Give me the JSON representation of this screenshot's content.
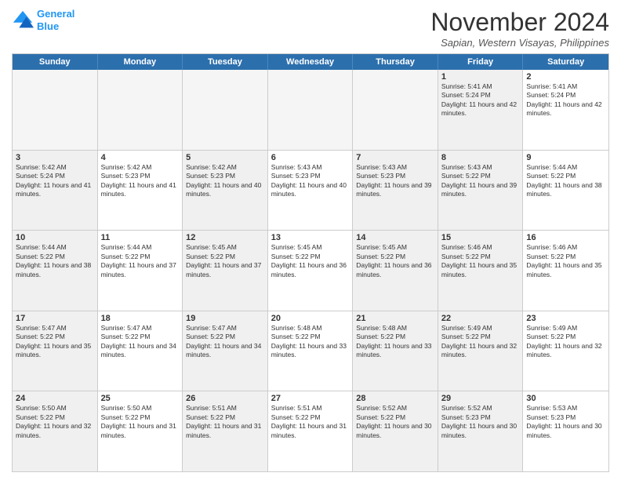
{
  "header": {
    "logo_line1": "General",
    "logo_line2": "Blue",
    "month": "November 2024",
    "location": "Sapian, Western Visayas, Philippines"
  },
  "weekdays": [
    "Sunday",
    "Monday",
    "Tuesday",
    "Wednesday",
    "Thursday",
    "Friday",
    "Saturday"
  ],
  "rows": [
    [
      {
        "day": "",
        "info": "",
        "empty": true
      },
      {
        "day": "",
        "info": "",
        "empty": true
      },
      {
        "day": "",
        "info": "",
        "empty": true
      },
      {
        "day": "",
        "info": "",
        "empty": true
      },
      {
        "day": "",
        "info": "",
        "empty": true
      },
      {
        "day": "1",
        "info": "Sunrise: 5:41 AM\nSunset: 5:24 PM\nDaylight: 11 hours and 42 minutes.",
        "shaded": true
      },
      {
        "day": "2",
        "info": "Sunrise: 5:41 AM\nSunset: 5:24 PM\nDaylight: 11 hours and 42 minutes."
      }
    ],
    [
      {
        "day": "3",
        "info": "Sunrise: 5:42 AM\nSunset: 5:24 PM\nDaylight: 11 hours and 41 minutes.",
        "shaded": true
      },
      {
        "day": "4",
        "info": "Sunrise: 5:42 AM\nSunset: 5:23 PM\nDaylight: 11 hours and 41 minutes."
      },
      {
        "day": "5",
        "info": "Sunrise: 5:42 AM\nSunset: 5:23 PM\nDaylight: 11 hours and 40 minutes.",
        "shaded": true
      },
      {
        "day": "6",
        "info": "Sunrise: 5:43 AM\nSunset: 5:23 PM\nDaylight: 11 hours and 40 minutes."
      },
      {
        "day": "7",
        "info": "Sunrise: 5:43 AM\nSunset: 5:23 PM\nDaylight: 11 hours and 39 minutes.",
        "shaded": true
      },
      {
        "day": "8",
        "info": "Sunrise: 5:43 AM\nSunset: 5:22 PM\nDaylight: 11 hours and 39 minutes.",
        "shaded": true
      },
      {
        "day": "9",
        "info": "Sunrise: 5:44 AM\nSunset: 5:22 PM\nDaylight: 11 hours and 38 minutes."
      }
    ],
    [
      {
        "day": "10",
        "info": "Sunrise: 5:44 AM\nSunset: 5:22 PM\nDaylight: 11 hours and 38 minutes.",
        "shaded": true
      },
      {
        "day": "11",
        "info": "Sunrise: 5:44 AM\nSunset: 5:22 PM\nDaylight: 11 hours and 37 minutes."
      },
      {
        "day": "12",
        "info": "Sunrise: 5:45 AM\nSunset: 5:22 PM\nDaylight: 11 hours and 37 minutes.",
        "shaded": true
      },
      {
        "day": "13",
        "info": "Sunrise: 5:45 AM\nSunset: 5:22 PM\nDaylight: 11 hours and 36 minutes."
      },
      {
        "day": "14",
        "info": "Sunrise: 5:45 AM\nSunset: 5:22 PM\nDaylight: 11 hours and 36 minutes.",
        "shaded": true
      },
      {
        "day": "15",
        "info": "Sunrise: 5:46 AM\nSunset: 5:22 PM\nDaylight: 11 hours and 35 minutes.",
        "shaded": true
      },
      {
        "day": "16",
        "info": "Sunrise: 5:46 AM\nSunset: 5:22 PM\nDaylight: 11 hours and 35 minutes."
      }
    ],
    [
      {
        "day": "17",
        "info": "Sunrise: 5:47 AM\nSunset: 5:22 PM\nDaylight: 11 hours and 35 minutes.",
        "shaded": true
      },
      {
        "day": "18",
        "info": "Sunrise: 5:47 AM\nSunset: 5:22 PM\nDaylight: 11 hours and 34 minutes."
      },
      {
        "day": "19",
        "info": "Sunrise: 5:47 AM\nSunset: 5:22 PM\nDaylight: 11 hours and 34 minutes.",
        "shaded": true
      },
      {
        "day": "20",
        "info": "Sunrise: 5:48 AM\nSunset: 5:22 PM\nDaylight: 11 hours and 33 minutes."
      },
      {
        "day": "21",
        "info": "Sunrise: 5:48 AM\nSunset: 5:22 PM\nDaylight: 11 hours and 33 minutes.",
        "shaded": true
      },
      {
        "day": "22",
        "info": "Sunrise: 5:49 AM\nSunset: 5:22 PM\nDaylight: 11 hours and 32 minutes.",
        "shaded": true
      },
      {
        "day": "23",
        "info": "Sunrise: 5:49 AM\nSunset: 5:22 PM\nDaylight: 11 hours and 32 minutes."
      }
    ],
    [
      {
        "day": "24",
        "info": "Sunrise: 5:50 AM\nSunset: 5:22 PM\nDaylight: 11 hours and 32 minutes.",
        "shaded": true
      },
      {
        "day": "25",
        "info": "Sunrise: 5:50 AM\nSunset: 5:22 PM\nDaylight: 11 hours and 31 minutes."
      },
      {
        "day": "26",
        "info": "Sunrise: 5:51 AM\nSunset: 5:22 PM\nDaylight: 11 hours and 31 minutes.",
        "shaded": true
      },
      {
        "day": "27",
        "info": "Sunrise: 5:51 AM\nSunset: 5:22 PM\nDaylight: 11 hours and 31 minutes."
      },
      {
        "day": "28",
        "info": "Sunrise: 5:52 AM\nSunset: 5:22 PM\nDaylight: 11 hours and 30 minutes.",
        "shaded": true
      },
      {
        "day": "29",
        "info": "Sunrise: 5:52 AM\nSunset: 5:23 PM\nDaylight: 11 hours and 30 minutes.",
        "shaded": true
      },
      {
        "day": "30",
        "info": "Sunrise: 5:53 AM\nSunset: 5:23 PM\nDaylight: 11 hours and 30 minutes."
      }
    ]
  ]
}
